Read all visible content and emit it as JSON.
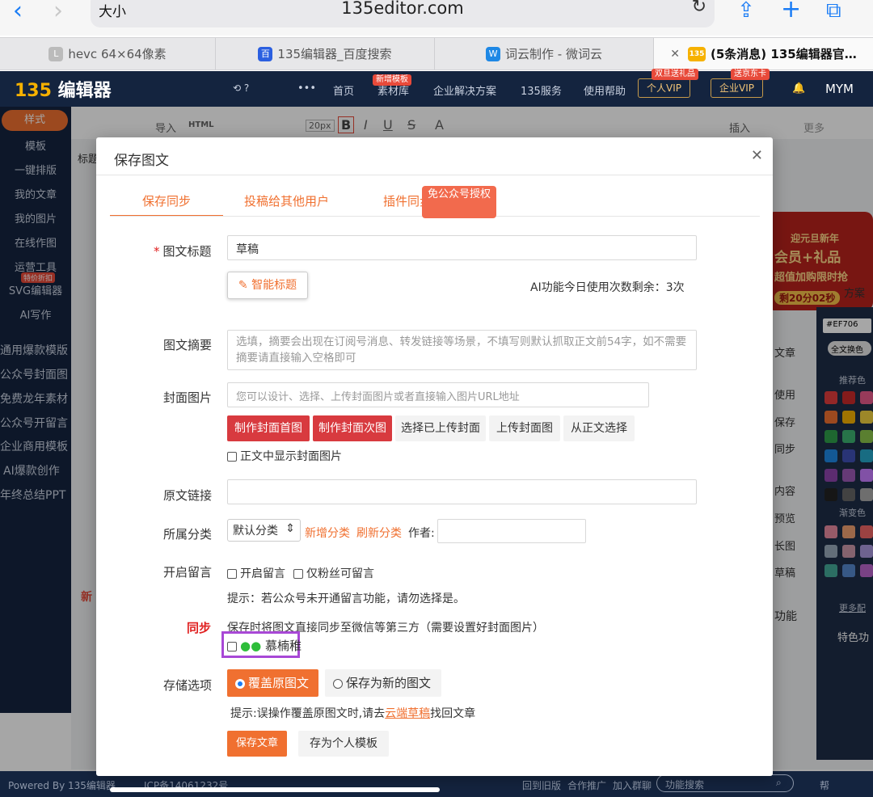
{
  "browser": {
    "aa_label": "大小",
    "url": "135editor.com",
    "tabs": [
      {
        "label": "hevc 64×64像素",
        "fav": "L"
      },
      {
        "label": "135编辑器_百度搜索",
        "fav": "百"
      },
      {
        "label": "词云制作 - 微词云",
        "fav": "W"
      },
      {
        "label": "(5条消息) 135编辑器官…",
        "fav": "135"
      }
    ]
  },
  "header": {
    "logo_prefix": "135",
    "logo_text": "编辑器",
    "nav": [
      "首页",
      "素材库",
      "企业解决方案",
      "135服务",
      "使用帮助"
    ],
    "nav_badge": "新增模板",
    "vip_personal": "个人VIP",
    "vip_personal_badge": "双旦送礼品",
    "vip_enterprise": "企业VIP",
    "vip_enterprise_badge": "送京东卡",
    "user": "MYM"
  },
  "sidebar": {
    "items": [
      "样式",
      "模板",
      "一键排版",
      "我的文章",
      "我的图片",
      "在线作图",
      "运营工具",
      "SVG编辑器",
      "AI写作"
    ],
    "badge": "特价折扣",
    "extra": [
      "通用爆款模版",
      "公众号封面图",
      "免费龙年素材",
      "公众号开留言",
      "企业商用模板",
      "AI爆款创作",
      "年终总结PPT"
    ]
  },
  "toolbar": {
    "import": "导入",
    "html": "HTML",
    "font_size": "20px",
    "insert": "插入",
    "more": "更多"
  },
  "background": {
    "title_label": "标题",
    "new_label": "新",
    "right_items": [
      "方案",
      "文章",
      "使用",
      "保存",
      "同步",
      "内容",
      "预览",
      "长图",
      "草稿",
      "功能"
    ],
    "color_hex": "#EF706",
    "color_btn": "全文换色",
    "recommend": "推荐色",
    "gradient": "渐变色",
    "more_colors": "更多配",
    "feature": "特色功",
    "promo_lines": [
      "迎元旦新年",
      "会员+礼品",
      "超值加购限时抢",
      "剩20分02秒"
    ]
  },
  "footer": {
    "powered": "Powered By 135编辑器",
    "icp": "ICP备14061232号",
    "links": [
      "回到旧版",
      "合作推广",
      "加入群聊"
    ],
    "search_placeholder": "功能搜索",
    "help": "帮"
  },
  "modal": {
    "title": "保存图文",
    "tabs": [
      "保存同步",
      "投稿给其他用户",
      "插件同步"
    ],
    "tip": "免公众号授权",
    "title_label": "图文标题",
    "title_value": "草稿",
    "ai_title_btn": "智能标题",
    "ai_remaining": "AI功能今日使用次数剩余：3次",
    "summary_label": "图文摘要",
    "summary_placeholder": "选填，摘要会出现在订阅号消息、转发链接等场景，不填写则默认抓取正文前54字，如不需要摘要请直接输入空格即可",
    "cover_label": "封面图片",
    "cover_placeholder": "您可以设计、选择、上传封面图片或者直接输入图片URL地址",
    "cover_buttons": [
      "制作封面首图",
      "制作封面次图",
      "选择已上传封面",
      "上传封面图",
      "从正文选择"
    ],
    "show_cover": "正文中显示封面图片",
    "link_label": "原文链接",
    "category_label": "所属分类",
    "category_value": "默认分类",
    "add_category": "新增分类",
    "refresh_category": "刷新分类",
    "author_label": "作者:",
    "comment_label": "开启留言",
    "comment_opt1": "开启留言",
    "comment_opt2": "仅粉丝可留言",
    "comment_tip": "提示：若公众号未开通留言功能，请勿选择是。",
    "sync_label": "同步",
    "sync_desc": "保存时将图文直接同步至微信等第三方（需要设置好封面图片）",
    "account_name": "慕楠稚",
    "storage_label": "存储选项",
    "overwrite": "覆盖原图文",
    "save_new": "保存为新的图文",
    "storage_tip_pre": "提示:误操作覆盖原图文时,请去",
    "storage_tip_link": "云端草稿",
    "storage_tip_post": "找回文章",
    "save_btn": "保存文章",
    "template_btn": "存为个人模板"
  }
}
